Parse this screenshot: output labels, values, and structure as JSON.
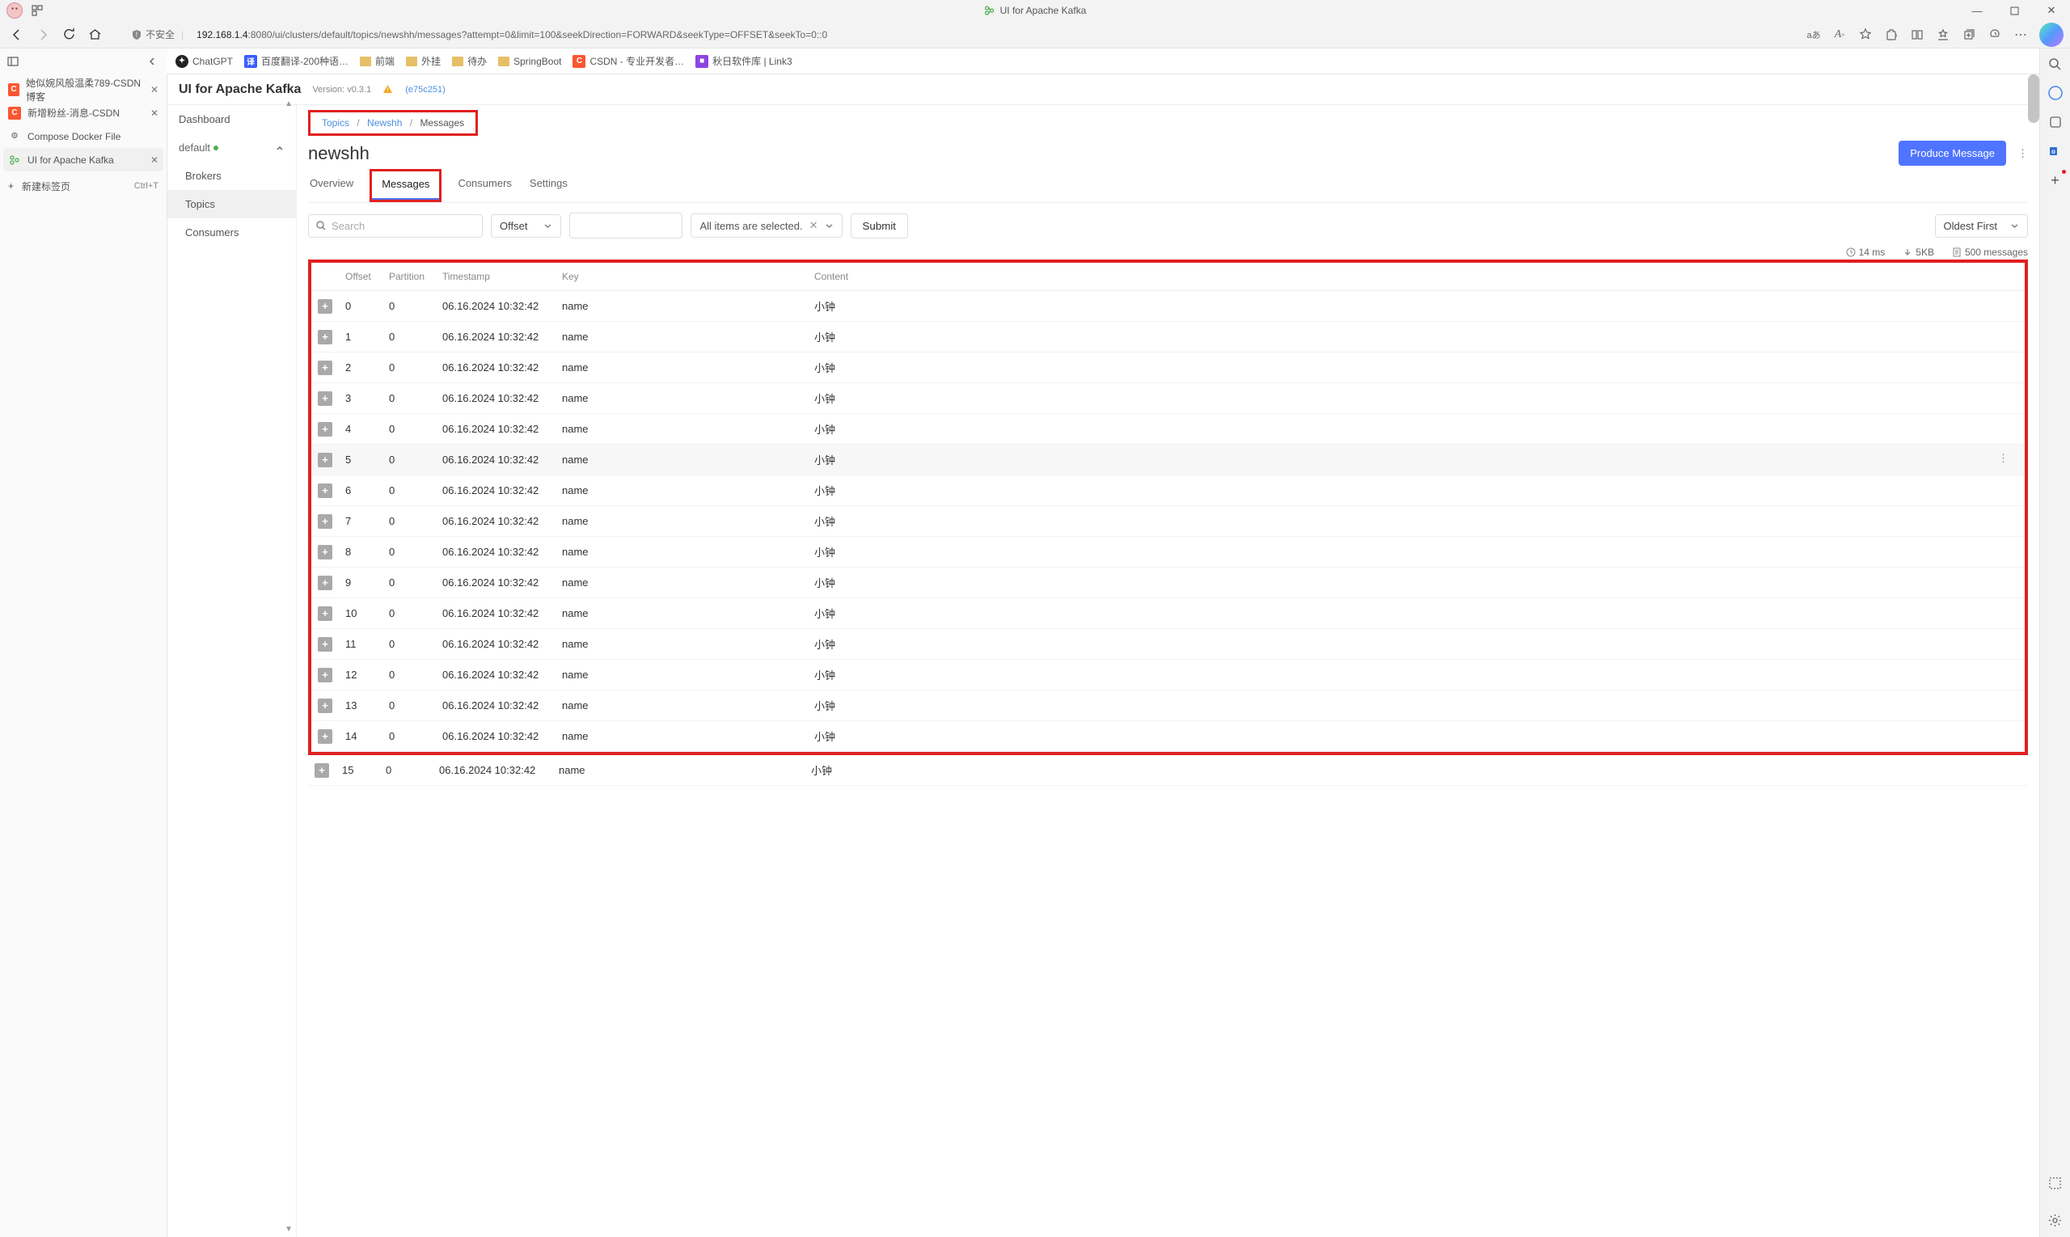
{
  "browser": {
    "page_title": "UI for Apache Kafka",
    "url_host": "192.168.1.4",
    "url_path": ":8080/ui/clusters/default/topics/newshh/messages?attempt=0&limit=100&seekDirection=FORWARD&seekType=OFFSET&seekTo=0::0",
    "not_secure": "不安全",
    "translate_label": "aあ",
    "vertical_tabs": [
      {
        "icon": "csdn",
        "label": "她似婉风般温柔789-CSDN博客"
      },
      {
        "icon": "csdn",
        "label": "新增粉丝-消息-CSDN"
      },
      {
        "icon": "dock",
        "label": "Compose Docker File"
      },
      {
        "icon": "kaf",
        "label": "UI for Apache Kafka",
        "active": true
      }
    ],
    "new_tab": "新建标签页",
    "new_tab_shortcut": "Ctrl+T",
    "bookmarks": [
      {
        "icon": "gpt",
        "label": "ChatGPT"
      },
      {
        "icon": "bd",
        "label": "百度翻译-200种语…"
      },
      {
        "icon": "folder",
        "label": "前端"
      },
      {
        "icon": "folder",
        "label": "外挂"
      },
      {
        "icon": "folder",
        "label": "待办"
      },
      {
        "icon": "folder",
        "label": "SpringBoot"
      },
      {
        "icon": "cs",
        "label": "CSDN - 专业开发者…"
      },
      {
        "icon": "au",
        "label": "秋日软件库 | Link3"
      }
    ]
  },
  "app": {
    "brand": "UI for Apache Kafka",
    "version": "Version: v0.3.1",
    "sha": "(e75c251)",
    "side_nav": {
      "dashboard": "Dashboard",
      "cluster": "default",
      "brokers": "Brokers",
      "topics": "Topics",
      "consumers": "Consumers"
    },
    "crumb": {
      "topics": "Topics",
      "topic": "Newshh",
      "cur": "Messages"
    },
    "topic_name": "newshh",
    "produce_btn": "Produce Message",
    "tabs": {
      "overview": "Overview",
      "messages": "Messages",
      "consumers": "Consumers",
      "settings": "Settings"
    },
    "filters": {
      "search_placeholder": "Search",
      "offset": "Offset",
      "all_selected": "All items are selected.",
      "submit": "Submit",
      "sort": "Oldest First"
    },
    "stats": {
      "time": "14 ms",
      "size": "5KB",
      "count": "500 messages"
    },
    "columns": {
      "offset": "Offset",
      "partition": "Partition",
      "timestamp": "Timestamp",
      "key": "Key",
      "content": "Content"
    },
    "rows": [
      {
        "offset": "0",
        "partition": "0",
        "ts": "06.16.2024 10:32:42",
        "key": "name",
        "content": "小钟"
      },
      {
        "offset": "1",
        "partition": "0",
        "ts": "06.16.2024 10:32:42",
        "key": "name",
        "content": "小钟"
      },
      {
        "offset": "2",
        "partition": "0",
        "ts": "06.16.2024 10:32:42",
        "key": "name",
        "content": "小钟"
      },
      {
        "offset": "3",
        "partition": "0",
        "ts": "06.16.2024 10:32:42",
        "key": "name",
        "content": "小钟"
      },
      {
        "offset": "4",
        "partition": "0",
        "ts": "06.16.2024 10:32:42",
        "key": "name",
        "content": "小钟"
      },
      {
        "offset": "5",
        "partition": "0",
        "ts": "06.16.2024 10:32:42",
        "key": "name",
        "content": "小钟",
        "hover": true
      },
      {
        "offset": "6",
        "partition": "0",
        "ts": "06.16.2024 10:32:42",
        "key": "name",
        "content": "小钟"
      },
      {
        "offset": "7",
        "partition": "0",
        "ts": "06.16.2024 10:32:42",
        "key": "name",
        "content": "小钟"
      },
      {
        "offset": "8",
        "partition": "0",
        "ts": "06.16.2024 10:32:42",
        "key": "name",
        "content": "小钟"
      },
      {
        "offset": "9",
        "partition": "0",
        "ts": "06.16.2024 10:32:42",
        "key": "name",
        "content": "小钟"
      },
      {
        "offset": "10",
        "partition": "0",
        "ts": "06.16.2024 10:32:42",
        "key": "name",
        "content": "小钟"
      },
      {
        "offset": "11",
        "partition": "0",
        "ts": "06.16.2024 10:32:42",
        "key": "name",
        "content": "小钟"
      },
      {
        "offset": "12",
        "partition": "0",
        "ts": "06.16.2024 10:32:42",
        "key": "name",
        "content": "小钟"
      },
      {
        "offset": "13",
        "partition": "0",
        "ts": "06.16.2024 10:32:42",
        "key": "name",
        "content": "小钟"
      },
      {
        "offset": "14",
        "partition": "0",
        "ts": "06.16.2024 10:32:42",
        "key": "name",
        "content": "小钟"
      },
      {
        "offset": "15",
        "partition": "0",
        "ts": "06.16.2024 10:32:42",
        "key": "name",
        "content": "小钟",
        "outside": true
      }
    ]
  }
}
